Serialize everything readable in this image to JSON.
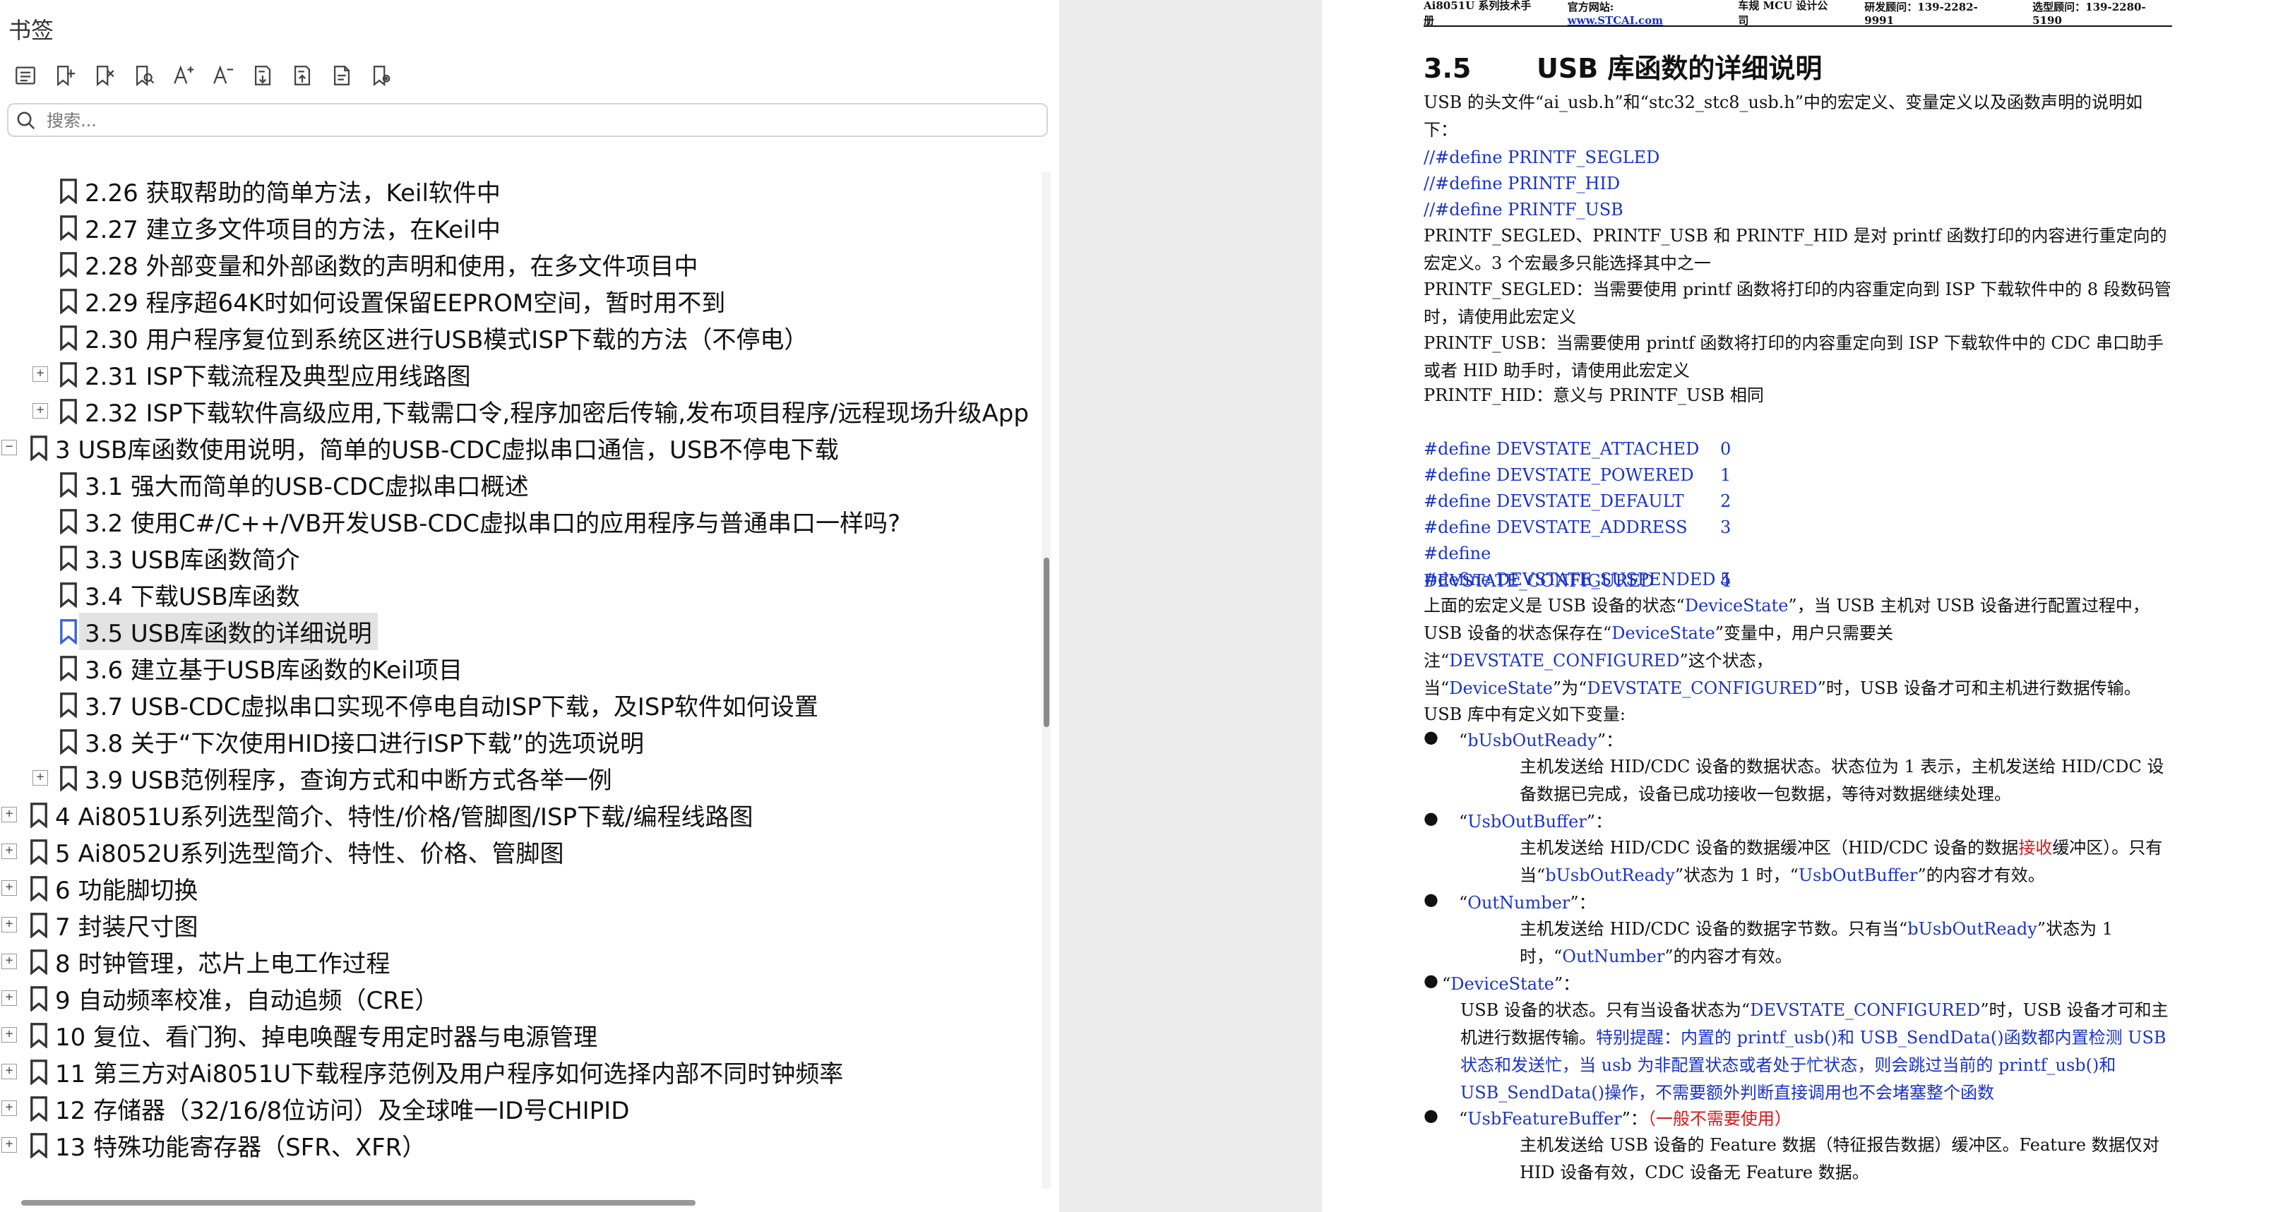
{
  "bookmarks": {
    "title": "书签",
    "search_placeholder": "搜索...",
    "toolbar": [
      "list-view-icon",
      "add-bookmark-icon",
      "delete-bookmark-icon",
      "search-bookmark-icon",
      "font-larger-icon",
      "font-smaller-icon",
      "expand-all-icon",
      "collapse-all-icon",
      "bookmark-file-icon",
      "bookmark-settings-icon"
    ],
    "items": [
      {
        "label": "2.26  获取帮助的简单方法，Keil软件中",
        "level": 2,
        "expandable": false,
        "selected": false
      },
      {
        "label": "2.27  建立多文件项目的方法，在Keil中",
        "level": 2,
        "expandable": false,
        "selected": false
      },
      {
        "label": "2.28 外部变量和外部函数的声明和使用，在多文件项目中",
        "level": 2,
        "expandable": false,
        "selected": false
      },
      {
        "label": "2.29  程序超64K时如何设置保留EEPROM空间，暂时用不到",
        "level": 2,
        "expandable": false,
        "selected": false
      },
      {
        "label": "2.30  用户程序复位到系统区进行USB模式ISP下载的方法（不停电）",
        "level": 2,
        "expandable": false,
        "selected": false
      },
      {
        "label": "2.31  ISP下载流程及典型应用线路图",
        "level": 2,
        "expandable": true,
        "selected": false
      },
      {
        "label": "2.32  ISP下载软件高级应用,下载需口令,程序加密后传输,发布项目程序/远程现场升级App",
        "level": 2,
        "expandable": true,
        "selected": false
      },
      {
        "label": "3  USB库函数使用说明，简单的USB-CDC虚拟串口通信，USB不停电下载",
        "level": 1,
        "expandable": true,
        "expanded": true,
        "selected": false
      },
      {
        "label": "3.1 强大而简单的USB-CDC虚拟串口概述",
        "level": 2,
        "expandable": false,
        "selected": false
      },
      {
        "label": "3.2  使用C#/C++/VB开发USB-CDC虚拟串口的应用程序与普通串口一样吗?",
        "level": 2,
        "expandable": false,
        "selected": false
      },
      {
        "label": "3.3  USB库函数简介",
        "level": 2,
        "expandable": false,
        "selected": false
      },
      {
        "label": "3.4 下载USB库函数",
        "level": 2,
        "expandable": false,
        "selected": false
      },
      {
        "label": "3.5  USB库函数的详细说明",
        "level": 2,
        "expandable": false,
        "selected": true
      },
      {
        "label": "3.6 建立基于USB库函数的Keil项目",
        "level": 2,
        "expandable": false,
        "selected": false
      },
      {
        "label": "3.7  USB-CDC虚拟串口实现不停电自动ISP下载，及ISP软件如何设置",
        "level": 2,
        "expandable": false,
        "selected": false
      },
      {
        "label": "3.8  关于“下次使用HID接口进行ISP下载”的选项说明",
        "level": 2,
        "expandable": false,
        "selected": false
      },
      {
        "label": "3.9  USB范例程序，查询方式和中断方式各举一例",
        "level": 2,
        "expandable": true,
        "selected": false
      },
      {
        "label": "4  Ai8051U系列选型简介、特性/价格/管脚图/ISP下载/编程线路图",
        "level": 1,
        "expandable": true,
        "selected": false
      },
      {
        "label": "5  Ai8052U系列选型简介、特性、价格、管脚图",
        "level": 1,
        "expandable": true,
        "selected": false
      },
      {
        "label": "6  功能脚切换",
        "level": 1,
        "expandable": true,
        "selected": false
      },
      {
        "label": "7  封装尺寸图",
        "level": 1,
        "expandable": true,
        "selected": false
      },
      {
        "label": "8  时钟管理，芯片上电工作过程",
        "level": 1,
        "expandable": true,
        "selected": false
      },
      {
        "label": "9  自动频率校准，自动追频（CRE）",
        "level": 1,
        "expandable": true,
        "selected": false
      },
      {
        "label": "10  复位、看门狗、掉电唤醒专用定时器与电源管理",
        "level": 1,
        "expandable": true,
        "selected": false
      },
      {
        "label": "11  第三方对Ai8051U下载程序范例及用户程序如何选择内部不同时钟频率",
        "level": 1,
        "expandable": true,
        "selected": false
      },
      {
        "label": "12  存储器（32/16/8位访问）及全球唯一ID号CHIPID",
        "level": 1,
        "expandable": true,
        "selected": false
      },
      {
        "label": "13  特殊功能寄存器（SFR、XFR）",
        "level": 1,
        "expandable": true,
        "selected": false
      }
    ]
  },
  "page": {
    "header": {
      "manual": "Ai8051U 系列技术手册",
      "site_label": "官方网站: ",
      "site_url": "www.STCAI.com",
      "company": "车规 MCU 设计公司",
      "rd_consult": "研发顾问：139-2282-9991",
      "sel_consult": "选型顾问：139-2280-5190"
    },
    "section_number": "3.5",
    "section_title": "USB 库函数的详细说明",
    "intro": "USB 的头文件“ai_usb.h”和“stc32_stc8_usb.h”中的宏定义、变量定义以及函数声明的说明如下：",
    "printf_defines": [
      "//#define PRINTF_SEGLED",
      "//#define PRINTF_HID",
      "//#define PRINTF_USB"
    ],
    "printf_desc": "PRINTF_SEGLED、PRINTF_USB 和 PRINTF_HID 是对 printf 函数打印的内容进行重定向的宏定义。3 个宏最多只能选择其中之一",
    "segled_desc": "PRINTF_SEGLED：当需要使用 printf 函数将打印的内容重定向到 ISP 下载软件中的 8 段数码管时，请使用此宏定义",
    "usb_desc": "PRINTF_USB：当需要使用 printf 函数将打印的内容重定向到 ISP 下载软件中的 CDC 串口助手或者 HID 助手时，请使用此宏定义",
    "hid_desc": "PRINTF_HID：意义与 PRINTF_USB 相同",
    "devstate_defines": [
      {
        "name": "#define DEVSTATE_ATTACHED",
        "value": "0"
      },
      {
        "name": "#define DEVSTATE_POWERED",
        "value": "1"
      },
      {
        "name": "#define DEVSTATE_DEFAULT",
        "value": "2"
      },
      {
        "name": "#define DEVSTATE_ADDRESS",
        "value": "3"
      },
      {
        "name": "#define DEVSTATE_CONFIGURED",
        "value": "4"
      },
      {
        "name": "#define DEVSTATE_SUSPENDED",
        "value": "5"
      }
    ],
    "devstate_p1": "上面的宏定义是 USB 设备的状态“",
    "devstate_var": "DeviceState",
    "devstate_p2": "”，当 USB 主机对 USB 设备进行配置过程中，USB 设备的状态保存在“",
    "devstate_p3": "”变量中，用户只需要关注“",
    "devstate_cfg": "DEVSTATE_CONFIGURED",
    "devstate_p4": "”这个状态，当“",
    "devstate_p5": "”为“",
    "devstate_p6": "”时，USB 设备才可和主机进行数据传输。",
    "vars_heading": "USB 库中有定义如下变量:",
    "b1_name": "bUsbOutReady",
    "b1_desc": "主机发送给 HID/CDC 设备的数据状态。状态位为 1 表示，主机发送给 HID/CDC 设备数据已完成，设备已成功接收一包数据，等待对数据继续处理。",
    "b2_name": "UsbOutBuffer",
    "b2_d1": "主机发送给  HID/CDC  设备的数据缓冲区（HID/CDC  设备的数据",
    "b2_red": "接收",
    "b2_d2": "缓冲区）。只有当“",
    "b2_d3": "”状态为 1 时，“",
    "b2_d4": "”的内容才有效。",
    "b3_name": "OutNumber",
    "b3_d1": "主机发送给 HID/CDC 设备的数据字节数。只有当“",
    "b3_d2": "”状态为 1 时，“",
    "b3_d3": "”的内容才有效。",
    "b4_name": "DeviceState",
    "b4_d1": "USB 设备的状态。只有当设备状态为“",
    "b4_d2": "”时，USB 设备才可和主机进行数据传输。",
    "b4_note": "特别提醒：内置的 printf_usb()和 USB_SendData()函数都内置检测 USB 状态和发送忙，当 usb 为非配置状态或者处于忙状态，则会跳过当前的 printf_usb()和 USB_SendData()操作，不需要额外判断直接调用也不会堵塞整个函数",
    "b5_name": "UsbFeatureBuffer",
    "b5_note": "（一般不需要使用）",
    "b5_desc": "主机发送给 USB 设备的 Feature 数据（特征报告数据）缓冲区。Feature 数据仅对 HID 设备有效，CDC 设备无 Feature 数据。"
  }
}
